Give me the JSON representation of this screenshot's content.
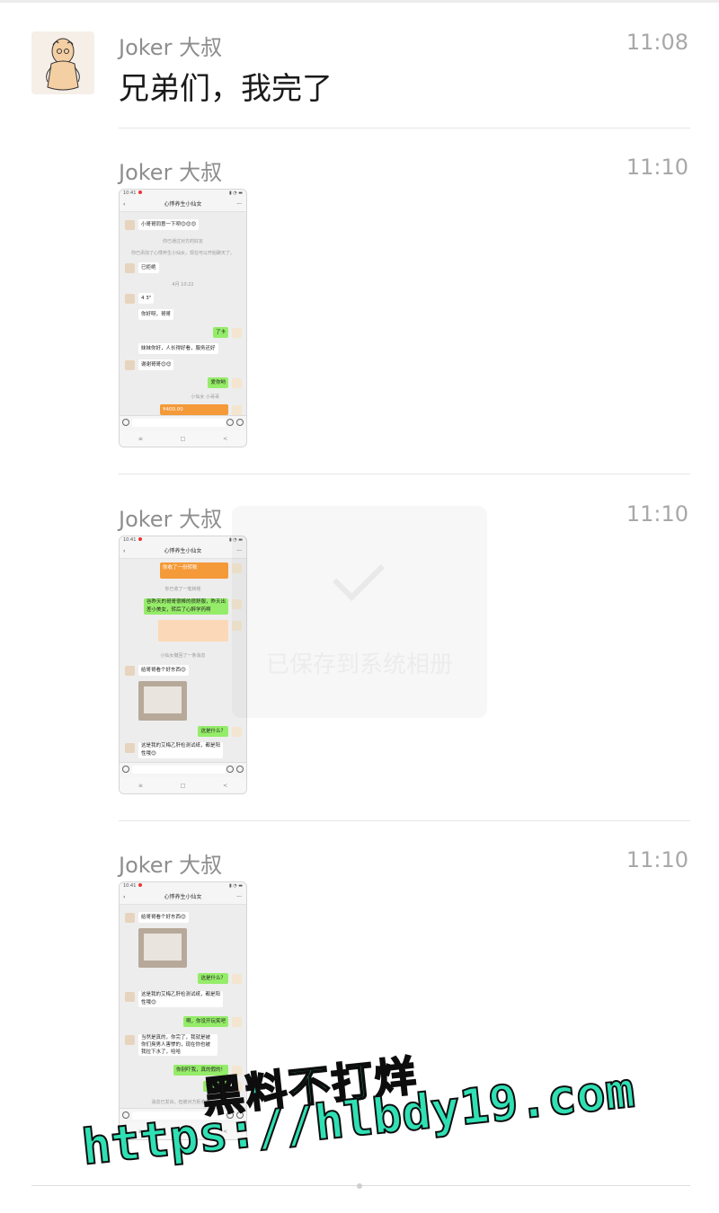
{
  "messages": [
    {
      "sender": "Joker 大叔",
      "time": "11:08",
      "text": "兄弟们，我完了"
    },
    {
      "sender": "Joker 大叔",
      "time": "11:10"
    },
    {
      "sender": "Joker 大叔",
      "time": "11:10"
    },
    {
      "sender": "Joker 大叔",
      "time": "11:10"
    }
  ],
  "screenshot_common": {
    "status_time": "10:41",
    "chat_title": "心悸养生小仙女",
    "back_icon": "chevron-left-icon",
    "more_icon": "ellipsis-icon",
    "nav_keys": [
      "≡",
      "□",
      "<"
    ]
  },
  "screenshot1": {
    "msg1": "小哥哥同意一下呗😊😊😊",
    "sys1": "你已通过对方的好友",
    "sys2": "你已添加了心悸养生小仙女，现在可以开始聊天了。",
    "call": "已拒绝",
    "sys3": "4月 10:22",
    "voice": "4 3\"",
    "msg2": "你好呀，哥哥",
    "out1": "了卡",
    "msg3": "妹妹你好，人长得好看，服务还好",
    "msg4": "谢谢哥哥😊😊",
    "out2": "爱你哟",
    "tags": "小仙女   小哥哥",
    "transfer": "¥400.00"
  },
  "screenshot2": {
    "transfer": "你收了一份转账",
    "sys1": "你已收了一笔转账",
    "out1": "谷昨天的哥哥很棒的很舒服，昨天出差小美女，转后了心醉学药啊",
    "sys2": "小仙女撤回了一条消息",
    "msg1": "给哥哥看个好东西😊",
    "out2": "这是什么？",
    "msg2": "这是我的艾梅乙肝检测试纸，都是阳性哦😊"
  },
  "screenshot3": {
    "msg1": "给哥哥看个好东西😊",
    "out1": "这是什么？",
    "msg2": "这是我的艾梅乙肝检测试纸，都是阳性哦😊",
    "out2": "啊，你没开玩笑吧",
    "msg3": "当然是真的，你完了，我就是被你们臭男人害惨的，现在你也被我拉下水了，哈哈",
    "out3": "你别吓我，真的假的！",
    "out4": "你害我！",
    "sys1": "消息已发出，但被对方拒收了。"
  },
  "overlay": {
    "text": "已保存到系统相册",
    "icon": "checkmark-icon"
  },
  "watermark": {
    "line1": "黑料不打烊",
    "line2": "https://hlbdy19.com"
  }
}
